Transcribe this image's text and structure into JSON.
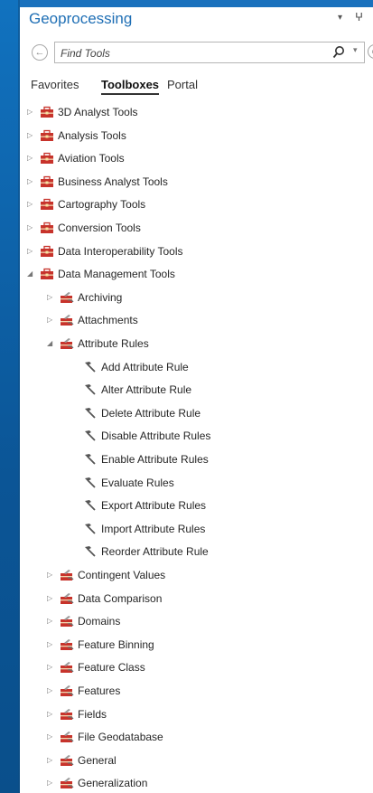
{
  "pane": {
    "title": "Geoprocessing",
    "menu_arrow": "▾",
    "pin": "ⵖ"
  },
  "search": {
    "back_glyph": "←",
    "placeholder": "Find Tools",
    "options_glyph": "▾",
    "cut_glyph": "⊘"
  },
  "tabs": [
    {
      "label": "Favorites",
      "active": false
    },
    {
      "label": "Toolboxes",
      "active": true
    },
    {
      "label": "Portal",
      "active": false
    }
  ],
  "icons": {
    "collapsed": "▷",
    "expanded": "◢",
    "toolbox_color": "#c7332b",
    "toolset_color": "#c7332b",
    "tool_color": "#555555"
  },
  "tree": [
    {
      "label": "3D Analyst Tools",
      "level": 0,
      "kind": "toolbox",
      "state": "collapsed"
    },
    {
      "label": "Analysis Tools",
      "level": 0,
      "kind": "toolbox",
      "state": "collapsed"
    },
    {
      "label": "Aviation Tools",
      "level": 0,
      "kind": "toolbox",
      "state": "collapsed"
    },
    {
      "label": "Business Analyst Tools",
      "level": 0,
      "kind": "toolbox",
      "state": "collapsed"
    },
    {
      "label": "Cartography Tools",
      "level": 0,
      "kind": "toolbox",
      "state": "collapsed"
    },
    {
      "label": "Conversion Tools",
      "level": 0,
      "kind": "toolbox",
      "state": "collapsed"
    },
    {
      "label": "Data Interoperability Tools",
      "level": 0,
      "kind": "toolbox",
      "state": "collapsed"
    },
    {
      "label": "Data Management Tools",
      "level": 0,
      "kind": "toolbox",
      "state": "expanded"
    },
    {
      "label": "Archiving",
      "level": 1,
      "kind": "toolset",
      "state": "collapsed"
    },
    {
      "label": "Attachments",
      "level": 1,
      "kind": "toolset",
      "state": "collapsed"
    },
    {
      "label": "Attribute Rules",
      "level": 1,
      "kind": "toolset",
      "state": "expanded"
    },
    {
      "label": "Add Attribute Rule",
      "level": 2,
      "kind": "tool",
      "state": "leaf"
    },
    {
      "label": "Alter Attribute Rule",
      "level": 2,
      "kind": "tool",
      "state": "leaf"
    },
    {
      "label": "Delete Attribute Rule",
      "level": 2,
      "kind": "tool",
      "state": "leaf"
    },
    {
      "label": "Disable Attribute Rules",
      "level": 2,
      "kind": "tool",
      "state": "leaf"
    },
    {
      "label": "Enable Attribute Rules",
      "level": 2,
      "kind": "tool",
      "state": "leaf"
    },
    {
      "label": "Evaluate Rules",
      "level": 2,
      "kind": "tool",
      "state": "leaf"
    },
    {
      "label": "Export Attribute Rules",
      "level": 2,
      "kind": "tool",
      "state": "leaf"
    },
    {
      "label": "Import Attribute Rules",
      "level": 2,
      "kind": "tool",
      "state": "leaf"
    },
    {
      "label": "Reorder Attribute Rule",
      "level": 2,
      "kind": "tool",
      "state": "leaf"
    },
    {
      "label": "Contingent Values",
      "level": 1,
      "kind": "toolset",
      "state": "collapsed"
    },
    {
      "label": "Data Comparison",
      "level": 1,
      "kind": "toolset",
      "state": "collapsed"
    },
    {
      "label": "Domains",
      "level": 1,
      "kind": "toolset",
      "state": "collapsed"
    },
    {
      "label": "Feature Binning",
      "level": 1,
      "kind": "toolset",
      "state": "collapsed"
    },
    {
      "label": "Feature Class",
      "level": 1,
      "kind": "toolset",
      "state": "collapsed"
    },
    {
      "label": "Features",
      "level": 1,
      "kind": "toolset",
      "state": "collapsed"
    },
    {
      "label": "Fields",
      "level": 1,
      "kind": "toolset",
      "state": "collapsed"
    },
    {
      "label": "File Geodatabase",
      "level": 1,
      "kind": "toolset",
      "state": "collapsed"
    },
    {
      "label": "General",
      "level": 1,
      "kind": "toolset",
      "state": "collapsed"
    },
    {
      "label": "Generalization",
      "level": 1,
      "kind": "toolset",
      "state": "collapsed"
    }
  ]
}
